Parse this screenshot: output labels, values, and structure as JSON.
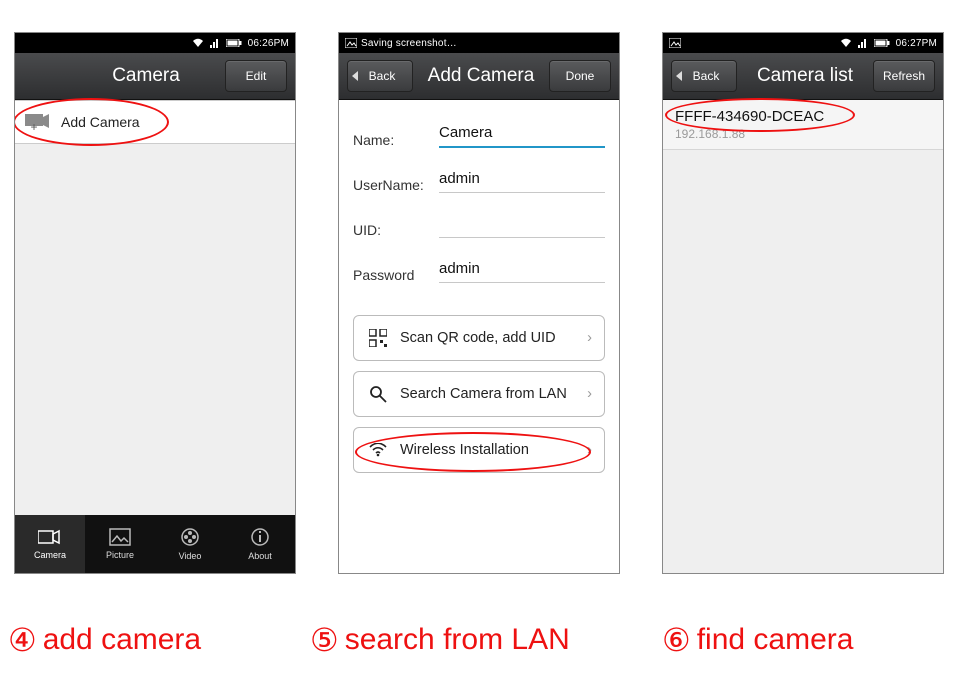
{
  "phone1": {
    "status_time": "06:26PM",
    "toolbar_title": "Camera",
    "edit_label": "Edit",
    "row_add_camera": "Add Camera",
    "nav": {
      "camera": "Camera",
      "picture": "Picture",
      "video": "Video",
      "about": "About"
    }
  },
  "phone2": {
    "status_text": "Saving screenshot…",
    "back_label": "Back",
    "toolbar_title": "Add Camera",
    "done_label": "Done",
    "form": {
      "name_label": "Name:",
      "name_value": "Camera",
      "username_label": "UserName:",
      "username_value": "admin",
      "uid_label": "UID:",
      "uid_value": "",
      "password_label": "Password",
      "password_value": "admin"
    },
    "actions": {
      "scan_qr": "Scan QR code, add UID",
      "search_lan": "Search Camera from LAN",
      "wireless": "Wireless Installation"
    }
  },
  "phone3": {
    "status_time": "06:27PM",
    "back_label": "Back",
    "toolbar_title": "Camera list",
    "refresh_label": "Refresh",
    "item": {
      "uid": "FFFF-434690-DCEAC",
      "ip": "192.168.1.88"
    }
  },
  "captions": {
    "n4": "④",
    "t4": "add camera",
    "n5": "⑤",
    "t5": "search from LAN",
    "n6": "⑥",
    "t6": "find camera"
  }
}
